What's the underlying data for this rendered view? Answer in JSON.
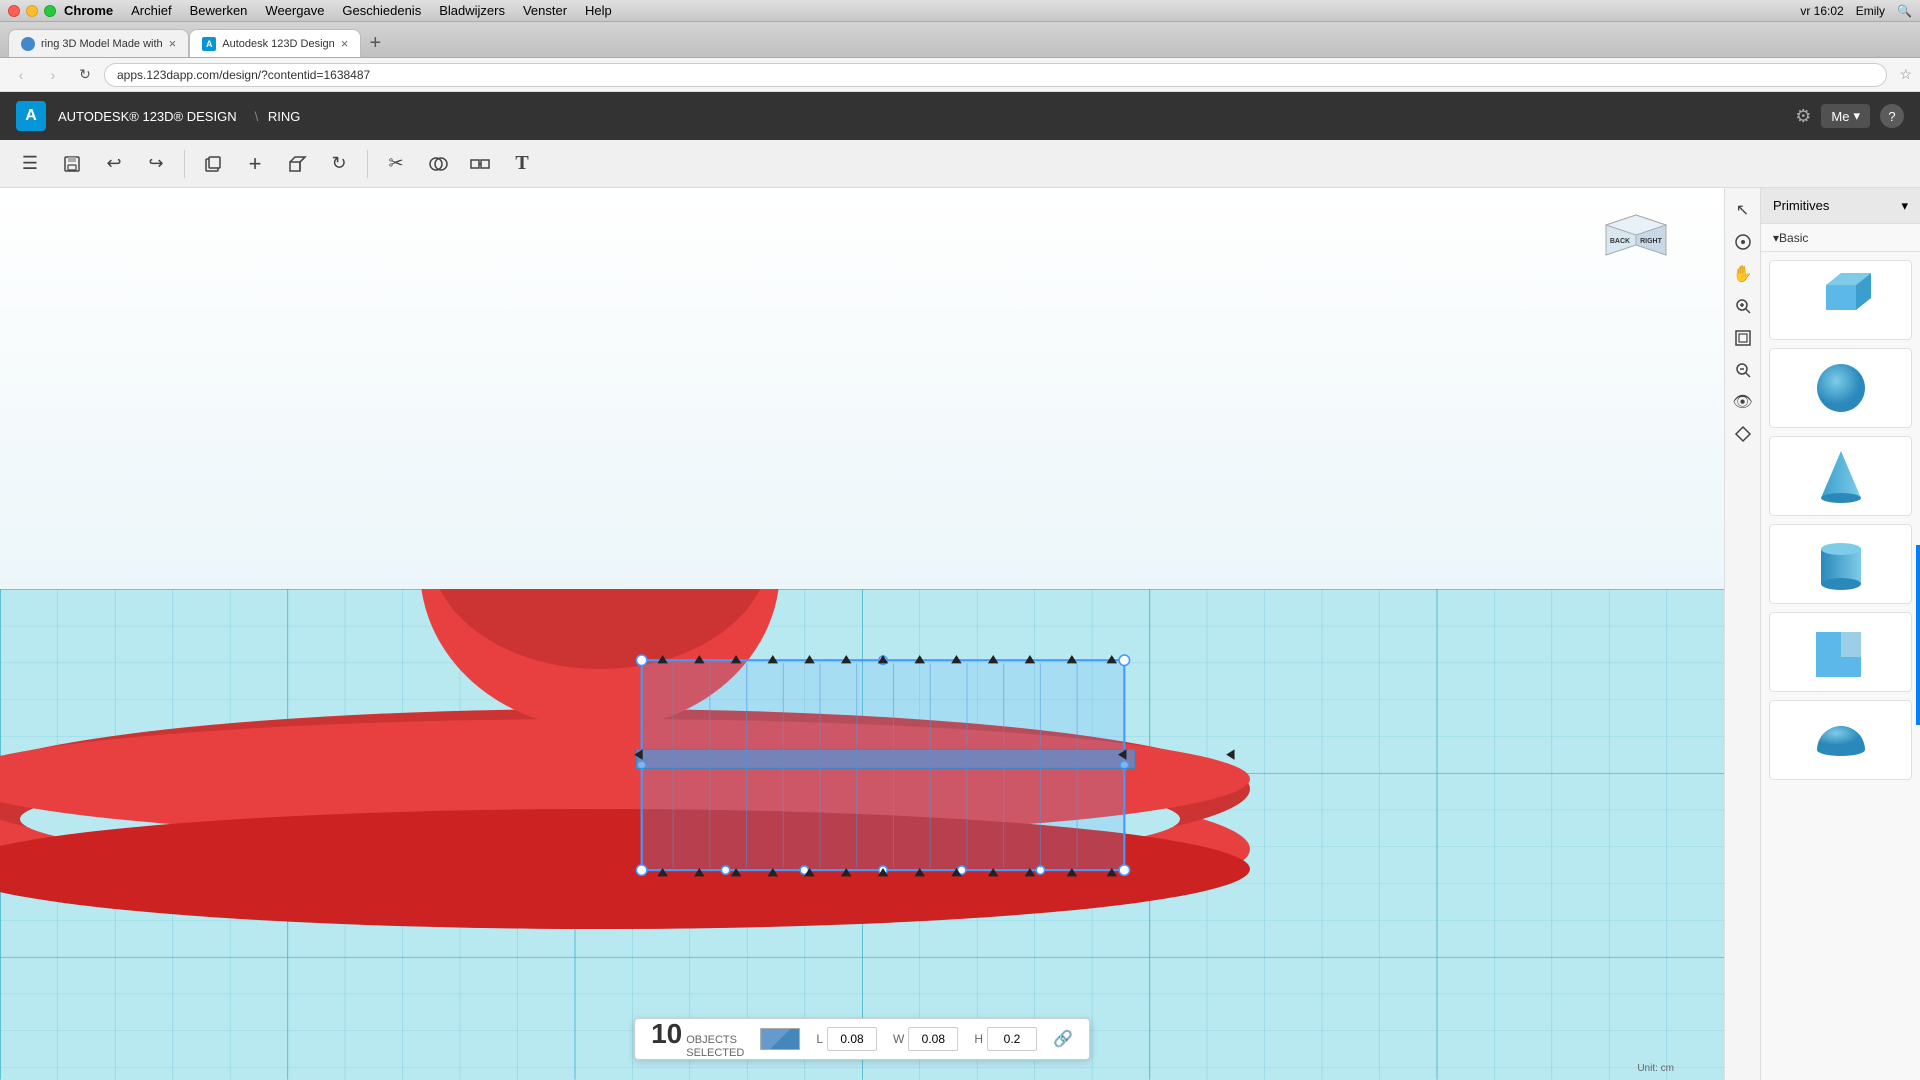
{
  "mac": {
    "menu_items": [
      "Chrome",
      "Archief",
      "Bewerken",
      "Weergave",
      "Geschiedenis",
      "Bladwijzers",
      "Venster",
      "Help"
    ],
    "time": "vr 16:02",
    "user": "Emily"
  },
  "browser": {
    "tabs": [
      {
        "id": "tab1",
        "label": "ring 3D Model Made with",
        "active": false,
        "favicon": "🔵"
      },
      {
        "id": "tab2",
        "label": "Autodesk 123D Design",
        "active": true,
        "favicon": "A"
      }
    ],
    "url": "apps.123dapp.com/design/?contentid=1638487"
  },
  "app": {
    "logo": "A",
    "brand": "AUTODESK® 123D® DESIGN",
    "separator": "\\",
    "project": "RING",
    "me_label": "Me",
    "help_label": "?",
    "settings_icon": "⚙"
  },
  "toolbar": {
    "buttons": [
      {
        "name": "menu",
        "icon": "☰",
        "label": "Menu"
      },
      {
        "name": "save",
        "icon": "💾",
        "label": "Save"
      },
      {
        "name": "undo",
        "icon": "↩",
        "label": "Undo"
      },
      {
        "name": "redo",
        "icon": "↪",
        "label": "Redo"
      },
      {
        "name": "copy",
        "icon": "⬜",
        "label": "Copy"
      },
      {
        "name": "add",
        "icon": "+",
        "label": "Add"
      },
      {
        "name": "extrude",
        "icon": "⬚",
        "label": "Extrude"
      },
      {
        "name": "refresh",
        "icon": "↻",
        "label": "Refresh"
      },
      {
        "name": "scissors",
        "icon": "✂",
        "label": "Scissors"
      },
      {
        "name": "combine",
        "icon": "⬡",
        "label": "Combine"
      },
      {
        "name": "group",
        "icon": "⬜",
        "label": "Group"
      },
      {
        "name": "text",
        "icon": "T",
        "label": "Text"
      }
    ]
  },
  "right_tools": [
    {
      "name": "select",
      "icon": "↖"
    },
    {
      "name": "orbit",
      "icon": "◎"
    },
    {
      "name": "pan",
      "icon": "✋"
    },
    {
      "name": "zoom",
      "icon": "🔍"
    },
    {
      "name": "fit",
      "icon": "⊡"
    },
    {
      "name": "zoom-section",
      "icon": "⊕"
    },
    {
      "name": "view",
      "icon": "👁"
    },
    {
      "name": "material",
      "icon": "◈"
    }
  ],
  "nav_cube": {
    "right_label": "RIGHT",
    "back_label": "BACK"
  },
  "selection": {
    "count": "10",
    "objects_label": "OBJECTS",
    "selected_label": "SELECTED",
    "l_label": "L",
    "l_value": "0.08",
    "w_label": "W",
    "w_value": "0.08",
    "h_label": "H",
    "h_value": "0.2"
  },
  "panel": {
    "title": "Primitives",
    "section": "Basic",
    "items": [
      {
        "name": "cube",
        "label": "Cube"
      },
      {
        "name": "sphere",
        "label": "Sphere"
      },
      {
        "name": "cone",
        "label": "Cone"
      },
      {
        "name": "cylinder",
        "label": "Cylinder"
      },
      {
        "name": "bracket",
        "label": "Bracket"
      },
      {
        "name": "half-sphere",
        "label": "Half Sphere"
      }
    ]
  },
  "unit_label": "Unit: cm"
}
